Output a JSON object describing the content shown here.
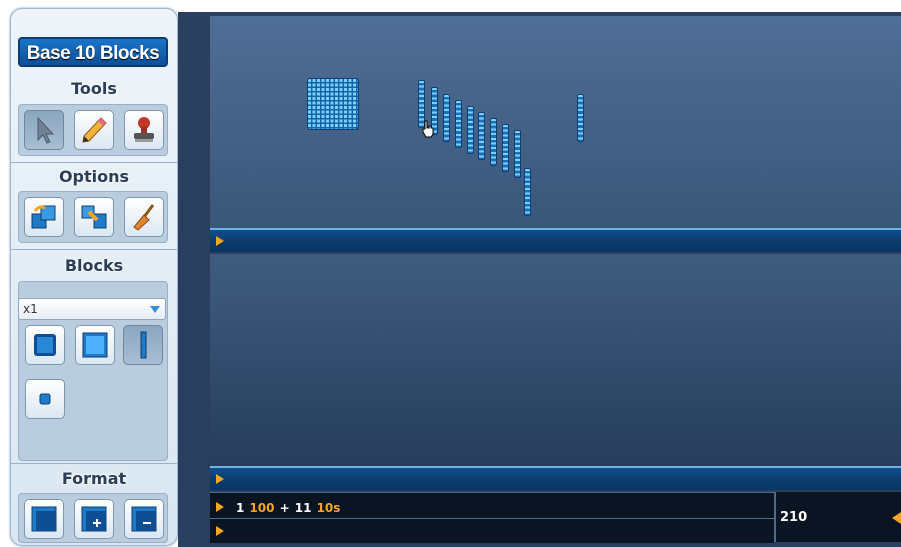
{
  "sidebar": {
    "title": "Base 10 Blocks",
    "sections": {
      "tools": "Tools",
      "options": "Options",
      "blocks": "Blocks",
      "format": "Format"
    },
    "blocks_select": {
      "value": "x1"
    }
  },
  "tool_icons": [
    "cursor-arrow-icon",
    "pencil-icon",
    "stamp-icon"
  ],
  "option_icons": [
    "rotate-block-icon",
    "break-block-icon",
    "broom-icon"
  ],
  "block_icons": [
    "cube-block-icon",
    "flat-block-icon",
    "rod-block-icon",
    "unit-block-icon"
  ],
  "format_icons": [
    "single-panel-icon",
    "add-panel-icon",
    "subtract-panel-icon"
  ],
  "expression": {
    "n1": "1",
    "v1": "100",
    "plus": "+",
    "n2": "11",
    "v2": "10s"
  },
  "total": "210",
  "colors": {
    "accent_orange": "#f5a623",
    "title_blue": "#0d4f97",
    "block_blue": "#1f7ac7"
  }
}
